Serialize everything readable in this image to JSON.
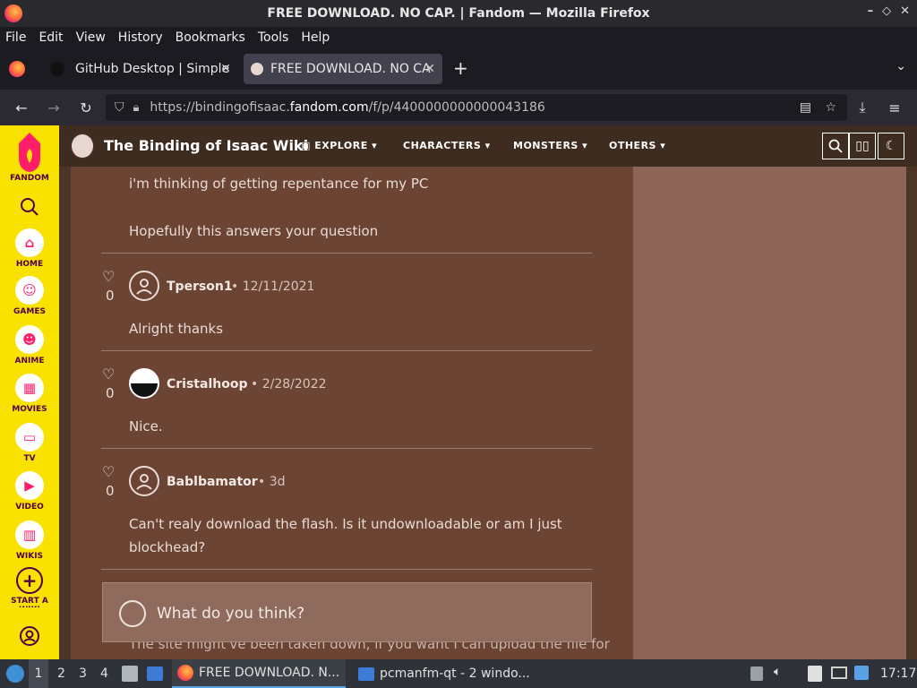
{
  "window": {
    "title": "FREE DOWNLOAD. NO CAP. | Fandom — Mozilla Firefox",
    "controls": [
      "–",
      "✕"
    ]
  },
  "menubar": [
    "File",
    "Edit",
    "View",
    "History",
    "Bookmarks",
    "Tools",
    "Help"
  ],
  "tabs": [
    {
      "label": "GitHub Desktop | Simple",
      "close": "✕"
    },
    {
      "label": "FREE DOWNLOAD. NO CA",
      "close": "✕"
    }
  ],
  "new_tab": "+",
  "url": {
    "prefix": "https://bindingofisaac.",
    "domain": "fandom.com",
    "path": "/f/p/4400000000000043186"
  },
  "fandom_rail": {
    "brand": "FANDOM",
    "items": [
      "HOME",
      "GAMES",
      "ANIME",
      "MOVIES",
      "TV",
      "VIDEO",
      "WIKIS",
      "START A WIKI"
    ]
  },
  "wiki": {
    "title": "The Binding of Isaac Wiki",
    "nav": [
      "EXPLORE",
      "CHARACTERS",
      "MONSTERS",
      "OTHERS"
    ]
  },
  "thread": {
    "partial": [
      "i'm thinking of getting repentance for my PC",
      "Hopefully this answers your question"
    ],
    "replies": [
      {
        "user": "Tperson1",
        "date": "12/11/2021",
        "text": "Alright thanks",
        "likes": "0"
      },
      {
        "user": "Cristalhoop",
        "date": "2/28/2022",
        "text": "Nice.",
        "likes": "0"
      },
      {
        "user": "Bablbamator",
        "date": "3d",
        "text_lines": [
          "Can't realy download the flash. Is it undownloadable or am I just",
          "blockhead?"
        ],
        "likes": "0"
      }
    ],
    "reply_placeholder": "What do you think?",
    "partial_bottom": "The site might've been taken down, if you want I can upload the file for"
  },
  "taskbar": {
    "workspaces": [
      "1",
      "2",
      "3",
      "4"
    ],
    "tasks": [
      "FREE DOWNLOAD. N...",
      "pcmanfm-qt - 2 windo..."
    ],
    "clock": "17:17"
  },
  "colors": {
    "fandom_yellow": "#fae200",
    "accent_pink": "#ff1e6a",
    "content_bg": "#6c4434"
  }
}
